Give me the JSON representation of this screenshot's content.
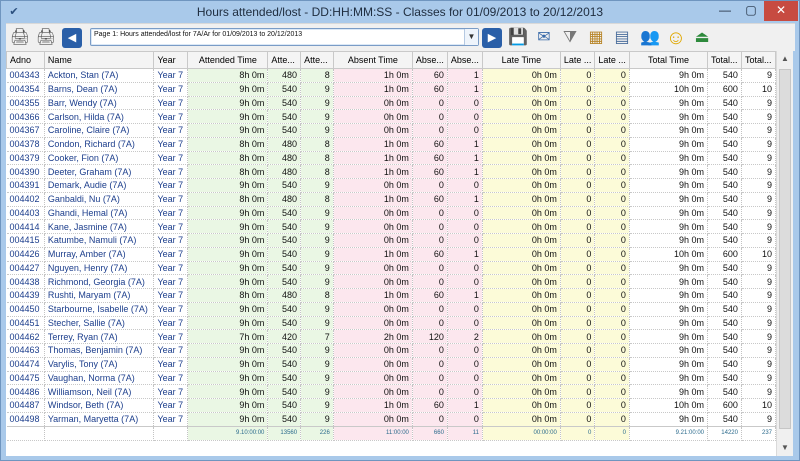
{
  "window": {
    "title": "Hours attended/lost - DD:HH:MM:SS - Classes for 01/09/2013 to 20/12/2013"
  },
  "toolbar": {
    "page_select_value": "Page 1: Hours attended/lost for 7A/Ar for 01/09/2013 to 20/12/2013",
    "buttons": [
      {
        "name": "print-icon",
        "glyph": "🖨"
      },
      {
        "name": "print-setup-icon",
        "glyph": "🖨"
      },
      {
        "name": "back-arrow-icon",
        "glyph": "◀"
      },
      {
        "name": "forward-arrow-icon",
        "glyph": "▶"
      },
      {
        "name": "save-icon",
        "glyph": "💾"
      },
      {
        "name": "email-icon",
        "glyph": "✉"
      },
      {
        "name": "filter-icon",
        "glyph": "⧩"
      },
      {
        "name": "columns-icon",
        "glyph": "▦"
      },
      {
        "name": "export-icon",
        "glyph": "▤"
      },
      {
        "name": "users-icon",
        "glyph": "👥"
      },
      {
        "name": "smiley-icon",
        "glyph": "☺"
      },
      {
        "name": "exit-icon",
        "glyph": "⏏"
      }
    ]
  },
  "table": {
    "columns": [
      "Adno",
      "Name",
      "Year",
      "Attended Time",
      "Atte...",
      "Atte...",
      "Absent Time",
      "Abse...",
      "Abse...",
      "Late Time",
      "Late ...",
      "Late ...",
      "Total Time",
      "Total...",
      "Total..."
    ],
    "rows": [
      [
        "004343",
        "Ackton, Stan (7A)",
        "Year  7",
        "8h 0m",
        "480",
        "8",
        "1h 0m",
        "60",
        "1",
        "0h 0m",
        "0",
        "0",
        "9h 0m",
        "540",
        "9"
      ],
      [
        "004354",
        "Barns, Dean (7A)",
        "Year  7",
        "9h 0m",
        "540",
        "9",
        "1h 0m",
        "60",
        "1",
        "0h 0m",
        "0",
        "0",
        "10h 0m",
        "600",
        "10"
      ],
      [
        "004355",
        "Barr, Wendy (7A)",
        "Year  7",
        "9h 0m",
        "540",
        "9",
        "0h 0m",
        "0",
        "0",
        "0h 0m",
        "0",
        "0",
        "9h 0m",
        "540",
        "9"
      ],
      [
        "004366",
        "Carlson, Hilda (7A)",
        "Year  7",
        "9h 0m",
        "540",
        "9",
        "0h 0m",
        "0",
        "0",
        "0h 0m",
        "0",
        "0",
        "9h 0m",
        "540",
        "9"
      ],
      [
        "004367",
        "Caroline, Claire (7A)",
        "Year  7",
        "9h 0m",
        "540",
        "9",
        "0h 0m",
        "0",
        "0",
        "0h 0m",
        "0",
        "0",
        "9h 0m",
        "540",
        "9"
      ],
      [
        "004378",
        "Condon, Richard (7A)",
        "Year  7",
        "8h 0m",
        "480",
        "8",
        "1h 0m",
        "60",
        "1",
        "0h 0m",
        "0",
        "0",
        "9h 0m",
        "540",
        "9"
      ],
      [
        "004379",
        "Cooker, Fion (7A)",
        "Year  7",
        "8h 0m",
        "480",
        "8",
        "1h 0m",
        "60",
        "1",
        "0h 0m",
        "0",
        "0",
        "9h 0m",
        "540",
        "9"
      ],
      [
        "004390",
        "Deeter, Graham (7A)",
        "Year  7",
        "8h 0m",
        "480",
        "8",
        "1h 0m",
        "60",
        "1",
        "0h 0m",
        "0",
        "0",
        "9h 0m",
        "540",
        "9"
      ],
      [
        "004391",
        "Demark, Audie (7A)",
        "Year  7",
        "9h 0m",
        "540",
        "9",
        "0h 0m",
        "0",
        "0",
        "0h 0m",
        "0",
        "0",
        "9h 0m",
        "540",
        "9"
      ],
      [
        "004402",
        "Ganbaldi, Nu (7A)",
        "Year  7",
        "8h 0m",
        "480",
        "8",
        "1h 0m",
        "60",
        "1",
        "0h 0m",
        "0",
        "0",
        "9h 0m",
        "540",
        "9"
      ],
      [
        "004403",
        "Ghandi, Hemal (7A)",
        "Year  7",
        "9h 0m",
        "540",
        "9",
        "0h 0m",
        "0",
        "0",
        "0h 0m",
        "0",
        "0",
        "9h 0m",
        "540",
        "9"
      ],
      [
        "004414",
        "Kane, Jasmine (7A)",
        "Year  7",
        "9h 0m",
        "540",
        "9",
        "0h 0m",
        "0",
        "0",
        "0h 0m",
        "0",
        "0",
        "9h 0m",
        "540",
        "9"
      ],
      [
        "004415",
        "Katumbe, Namuli (7A)",
        "Year  7",
        "9h 0m",
        "540",
        "9",
        "0h 0m",
        "0",
        "0",
        "0h 0m",
        "0",
        "0",
        "9h 0m",
        "540",
        "9"
      ],
      [
        "004426",
        "Murray, Amber (7A)",
        "Year  7",
        "9h 0m",
        "540",
        "9",
        "1h 0m",
        "60",
        "1",
        "0h 0m",
        "0",
        "0",
        "10h 0m",
        "600",
        "10"
      ],
      [
        "004427",
        "Nguyen, Henry (7A)",
        "Year  7",
        "9h 0m",
        "540",
        "9",
        "0h 0m",
        "0",
        "0",
        "0h 0m",
        "0",
        "0",
        "9h 0m",
        "540",
        "9"
      ],
      [
        "004438",
        "Richmond, Georgia (7A)",
        "Year  7",
        "9h 0m",
        "540",
        "9",
        "0h 0m",
        "0",
        "0",
        "0h 0m",
        "0",
        "0",
        "9h 0m",
        "540",
        "9"
      ],
      [
        "004439",
        "Rushti, Maryam (7A)",
        "Year  7",
        "8h 0m",
        "480",
        "8",
        "1h 0m",
        "60",
        "1",
        "0h 0m",
        "0",
        "0",
        "9h 0m",
        "540",
        "9"
      ],
      [
        "004450",
        "Starbourne, Isabelle (7A)",
        "Year  7",
        "9h 0m",
        "540",
        "9",
        "0h 0m",
        "0",
        "0",
        "0h 0m",
        "0",
        "0",
        "9h 0m",
        "540",
        "9"
      ],
      [
        "004451",
        "Stecher, Sallie (7A)",
        "Year  7",
        "9h 0m",
        "540",
        "9",
        "0h 0m",
        "0",
        "0",
        "0h 0m",
        "0",
        "0",
        "9h 0m",
        "540",
        "9"
      ],
      [
        "004462",
        "Terrey, Ryan (7A)",
        "Year  7",
        "7h 0m",
        "420",
        "7",
        "2h 0m",
        "120",
        "2",
        "0h 0m",
        "0",
        "0",
        "9h 0m",
        "540",
        "9"
      ],
      [
        "004463",
        "Thomas, Benjamin (7A)",
        "Year  7",
        "9h 0m",
        "540",
        "9",
        "0h 0m",
        "0",
        "0",
        "0h 0m",
        "0",
        "0",
        "9h 0m",
        "540",
        "9"
      ],
      [
        "004474",
        "Varylis, Tony (7A)",
        "Year  7",
        "9h 0m",
        "540",
        "9",
        "0h 0m",
        "0",
        "0",
        "0h 0m",
        "0",
        "0",
        "9h 0m",
        "540",
        "9"
      ],
      [
        "004475",
        "Vaughan, Norma (7A)",
        "Year  7",
        "9h 0m",
        "540",
        "9",
        "0h 0m",
        "0",
        "0",
        "0h 0m",
        "0",
        "0",
        "9h 0m",
        "540",
        "9"
      ],
      [
        "004486",
        "Williamson, Neil (7A)",
        "Year  7",
        "9h 0m",
        "540",
        "9",
        "0h 0m",
        "0",
        "0",
        "0h 0m",
        "0",
        "0",
        "9h 0m",
        "540",
        "9"
      ],
      [
        "004487",
        "Windsor, Beth (7A)",
        "Year  7",
        "9h 0m",
        "540",
        "9",
        "1h 0m",
        "60",
        "1",
        "0h 0m",
        "0",
        "0",
        "10h 0m",
        "600",
        "10"
      ],
      [
        "004498",
        "Yarman, Maryetta (7A)",
        "Year  7",
        "9h 0m",
        "540",
        "9",
        "0h 0m",
        "0",
        "0",
        "0h 0m",
        "0",
        "0",
        "9h 0m",
        "540",
        "9"
      ]
    ],
    "totals": [
      "",
      "",
      "",
      "9.10:00:00",
      "13560",
      "226",
      "11:00:00",
      "660",
      "11",
      "00:00:00",
      "0",
      "0",
      "9.21:00:00",
      "14220",
      "237"
    ]
  }
}
